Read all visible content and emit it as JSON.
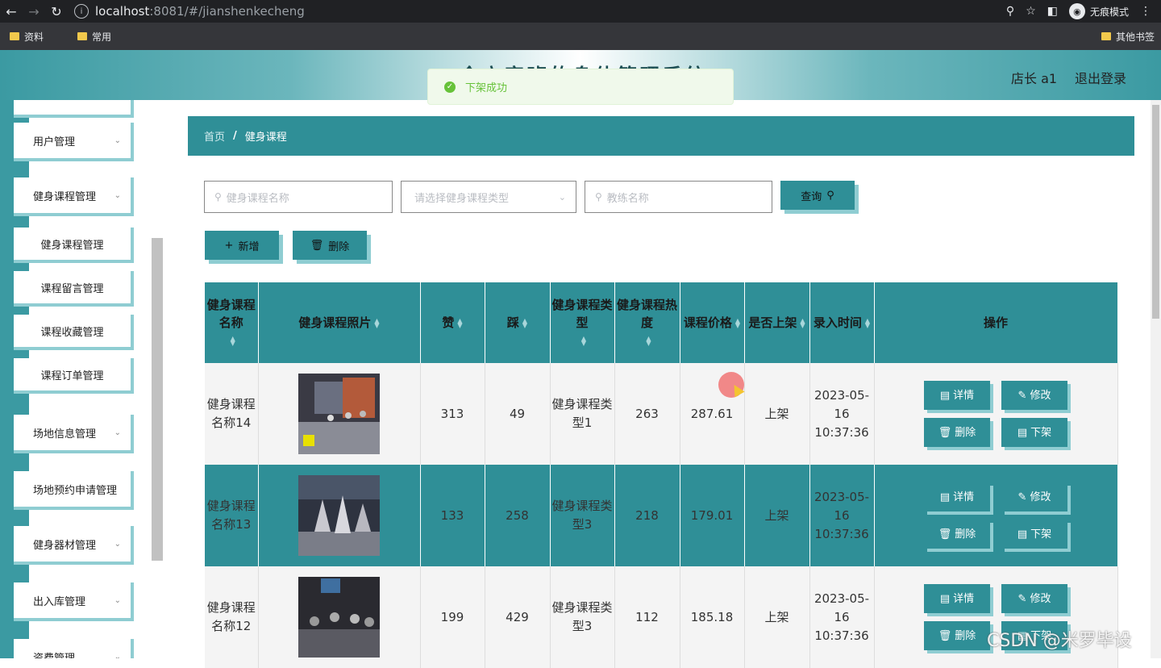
{
  "browser": {
    "url_host": "localhost",
    "url_rest": ":8081/#/jianshenkecheng",
    "incognito_label": "无痕模式",
    "bookmarks": [
      "资料",
      "常用"
    ],
    "bookmarks_right": "其他书签"
  },
  "header": {
    "title": "今立客班的身体管理系统",
    "user": "店长 a1",
    "logout": "退出登录"
  },
  "toast": {
    "message": "下架成功"
  },
  "sidebar": {
    "items": [
      {
        "label": "用户管理"
      },
      {
        "label": "健身课程管理"
      },
      {
        "label": "场地信息管理"
      },
      {
        "label": "场地预约申请管理"
      },
      {
        "label": "健身器材管理"
      },
      {
        "label": "出入库管理"
      },
      {
        "label": "资费管理"
      }
    ],
    "sub_items": [
      "健身课程管理",
      "课程留言管理",
      "课程收藏管理",
      "课程订单管理"
    ]
  },
  "breadcrumb": {
    "home": "首页",
    "sep": "/",
    "current": "健身课程"
  },
  "search": {
    "name_placeholder": "健身课程名称",
    "type_placeholder": "请选择健身课程类型",
    "coach_placeholder": "教练名称",
    "query_label": "查询"
  },
  "actions": {
    "add_label": "新增",
    "delete_label": "删除"
  },
  "table": {
    "headers": [
      "健身课程名称",
      "健身课程照片",
      "赞",
      "踩",
      "健身课程类型",
      "健身课程热度",
      "课程价格",
      "是否上架",
      "录入时间",
      "操作"
    ],
    "rows": [
      {
        "name": "健身课程名称14",
        "like": "313",
        "dislike": "49",
        "type": "健身课程类型1",
        "heat": "263",
        "price": "287.61",
        "status": "上架",
        "time": "2023-05-16 10:37:36"
      },
      {
        "name": "健身课程名称13",
        "like": "133",
        "dislike": "258",
        "type": "健身课程类型3",
        "heat": "218",
        "price": "179.01",
        "status": "上架",
        "time": "2023-05-16 10:37:36"
      },
      {
        "name": "健身课程名称12",
        "like": "199",
        "dislike": "429",
        "type": "健身课程类型3",
        "heat": "112",
        "price": "185.18",
        "status": "上架",
        "time": "2023-05-16 10:37:36"
      }
    ],
    "op_labels": {
      "detail": "详情",
      "edit": "修改",
      "delete": "删除",
      "offshelf": "下架"
    }
  },
  "watermark": "CSDN @米罗毕设"
}
